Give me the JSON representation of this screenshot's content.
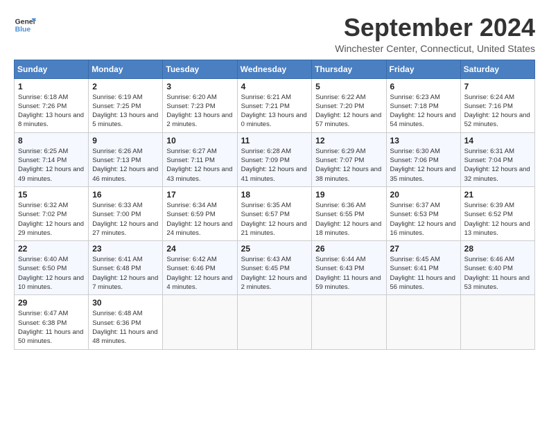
{
  "logo": {
    "text_general": "General",
    "text_blue": "Blue",
    "icon_title": "GeneralBlue logo"
  },
  "header": {
    "month_title": "September 2024",
    "location": "Winchester Center, Connecticut, United States"
  },
  "weekdays": [
    "Sunday",
    "Monday",
    "Tuesday",
    "Wednesday",
    "Thursday",
    "Friday",
    "Saturday"
  ],
  "weeks": [
    [
      {
        "day": "1",
        "sunrise": "6:18 AM",
        "sunset": "7:26 PM",
        "daylight": "13 hours and 8 minutes."
      },
      {
        "day": "2",
        "sunrise": "6:19 AM",
        "sunset": "7:25 PM",
        "daylight": "13 hours and 5 minutes."
      },
      {
        "day": "3",
        "sunrise": "6:20 AM",
        "sunset": "7:23 PM",
        "daylight": "13 hours and 2 minutes."
      },
      {
        "day": "4",
        "sunrise": "6:21 AM",
        "sunset": "7:21 PM",
        "daylight": "13 hours and 0 minutes."
      },
      {
        "day": "5",
        "sunrise": "6:22 AM",
        "sunset": "7:20 PM",
        "daylight": "12 hours and 57 minutes."
      },
      {
        "day": "6",
        "sunrise": "6:23 AM",
        "sunset": "7:18 PM",
        "daylight": "12 hours and 54 minutes."
      },
      {
        "day": "7",
        "sunrise": "6:24 AM",
        "sunset": "7:16 PM",
        "daylight": "12 hours and 52 minutes."
      }
    ],
    [
      {
        "day": "8",
        "sunrise": "6:25 AM",
        "sunset": "7:14 PM",
        "daylight": "12 hours and 49 minutes."
      },
      {
        "day": "9",
        "sunrise": "6:26 AM",
        "sunset": "7:13 PM",
        "daylight": "12 hours and 46 minutes."
      },
      {
        "day": "10",
        "sunrise": "6:27 AM",
        "sunset": "7:11 PM",
        "daylight": "12 hours and 43 minutes."
      },
      {
        "day": "11",
        "sunrise": "6:28 AM",
        "sunset": "7:09 PM",
        "daylight": "12 hours and 41 minutes."
      },
      {
        "day": "12",
        "sunrise": "6:29 AM",
        "sunset": "7:07 PM",
        "daylight": "12 hours and 38 minutes."
      },
      {
        "day": "13",
        "sunrise": "6:30 AM",
        "sunset": "7:06 PM",
        "daylight": "12 hours and 35 minutes."
      },
      {
        "day": "14",
        "sunrise": "6:31 AM",
        "sunset": "7:04 PM",
        "daylight": "12 hours and 32 minutes."
      }
    ],
    [
      {
        "day": "15",
        "sunrise": "6:32 AM",
        "sunset": "7:02 PM",
        "daylight": "12 hours and 29 minutes."
      },
      {
        "day": "16",
        "sunrise": "6:33 AM",
        "sunset": "7:00 PM",
        "daylight": "12 hours and 27 minutes."
      },
      {
        "day": "17",
        "sunrise": "6:34 AM",
        "sunset": "6:59 PM",
        "daylight": "12 hours and 24 minutes."
      },
      {
        "day": "18",
        "sunrise": "6:35 AM",
        "sunset": "6:57 PM",
        "daylight": "12 hours and 21 minutes."
      },
      {
        "day": "19",
        "sunrise": "6:36 AM",
        "sunset": "6:55 PM",
        "daylight": "12 hours and 18 minutes."
      },
      {
        "day": "20",
        "sunrise": "6:37 AM",
        "sunset": "6:53 PM",
        "daylight": "12 hours and 16 minutes."
      },
      {
        "day": "21",
        "sunrise": "6:39 AM",
        "sunset": "6:52 PM",
        "daylight": "12 hours and 13 minutes."
      }
    ],
    [
      {
        "day": "22",
        "sunrise": "6:40 AM",
        "sunset": "6:50 PM",
        "daylight": "12 hours and 10 minutes."
      },
      {
        "day": "23",
        "sunrise": "6:41 AM",
        "sunset": "6:48 PM",
        "daylight": "12 hours and 7 minutes."
      },
      {
        "day": "24",
        "sunrise": "6:42 AM",
        "sunset": "6:46 PM",
        "daylight": "12 hours and 4 minutes."
      },
      {
        "day": "25",
        "sunrise": "6:43 AM",
        "sunset": "6:45 PM",
        "daylight": "12 hours and 2 minutes."
      },
      {
        "day": "26",
        "sunrise": "6:44 AM",
        "sunset": "6:43 PM",
        "daylight": "11 hours and 59 minutes."
      },
      {
        "day": "27",
        "sunrise": "6:45 AM",
        "sunset": "6:41 PM",
        "daylight": "11 hours and 56 minutes."
      },
      {
        "day": "28",
        "sunrise": "6:46 AM",
        "sunset": "6:40 PM",
        "daylight": "11 hours and 53 minutes."
      }
    ],
    [
      {
        "day": "29",
        "sunrise": "6:47 AM",
        "sunset": "6:38 PM",
        "daylight": "11 hours and 50 minutes."
      },
      {
        "day": "30",
        "sunrise": "6:48 AM",
        "sunset": "6:36 PM",
        "daylight": "11 hours and 48 minutes."
      },
      null,
      null,
      null,
      null,
      null
    ]
  ]
}
